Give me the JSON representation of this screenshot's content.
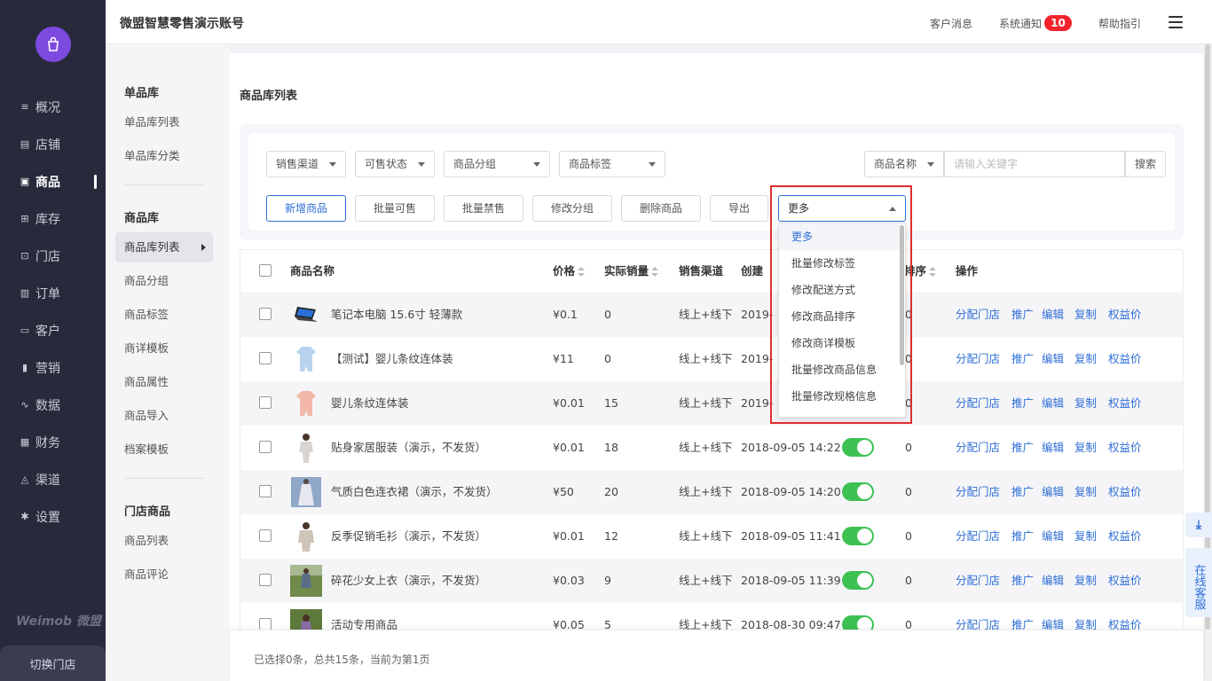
{
  "header": {
    "account_name": "微盟智慧零售演示账号",
    "customer_msg": "客户消息",
    "sys_notice": "系统通知",
    "notice_count": "10",
    "help": "帮助指引"
  },
  "nav": {
    "items": [
      {
        "label": "概况",
        "icon": "overview-icon"
      },
      {
        "label": "店铺",
        "icon": "shop-icon"
      },
      {
        "label": "商品",
        "icon": "goods-icon"
      },
      {
        "label": "库存",
        "icon": "inventory-icon"
      },
      {
        "label": "门店",
        "icon": "store-icon"
      },
      {
        "label": "订单",
        "icon": "order-icon"
      },
      {
        "label": "客户",
        "icon": "customer-icon"
      },
      {
        "label": "营销",
        "icon": "marketing-icon"
      },
      {
        "label": "数据",
        "icon": "data-icon"
      },
      {
        "label": "财务",
        "icon": "finance-icon"
      },
      {
        "label": "渠道",
        "icon": "channel-icon"
      },
      {
        "label": "设置",
        "icon": "settings-icon"
      }
    ],
    "active": "商品",
    "brand": "Weimob 微盟",
    "switch_store": "切换门店"
  },
  "subnav": {
    "group1": {
      "title": "单品库",
      "items": [
        "单品库列表",
        "单品库分类"
      ]
    },
    "group2": {
      "title": "商品库",
      "items": [
        "商品库列表",
        "商品分组",
        "商品标签",
        "商详模板",
        "商品属性",
        "商品导入",
        "档案模板"
      ]
    },
    "group3": {
      "title": "门店商品",
      "items": [
        "商品列表",
        "商品评论"
      ]
    },
    "active": "商品库列表"
  },
  "page": {
    "title": "商品库列表"
  },
  "filters": {
    "sales_channel": "销售渠道",
    "sale_status": "可售状态",
    "goods_group": "商品分组",
    "goods_tag": "商品标签",
    "search_field": "商品名称",
    "search_placeholder": "请输入关键字",
    "search_btn": "搜索"
  },
  "actions": {
    "add": "新增商品",
    "batch_sellable": "批量可售",
    "batch_forbid": "批量禁售",
    "modify_group": "修改分组",
    "delete": "删除商品",
    "export": "导出",
    "more": "更多"
  },
  "more_menu": {
    "options": [
      "更多",
      "批量修改标签",
      "修改配送方式",
      "修改商品排序",
      "修改商详模板",
      "批量修改商品信息",
      "批量修改规格信息"
    ],
    "selected": "更多"
  },
  "table": {
    "columns": {
      "name": "商品名称",
      "price": "价格",
      "sales": "实际销量",
      "channel": "销售渠道",
      "created": "创建",
      "sort": "排序",
      "ops": "操作"
    },
    "op_labels": [
      "分配门店",
      "推广",
      "编辑",
      "复制",
      "权益价"
    ],
    "rows": [
      {
        "name": "笔记本电脑 15.6寸 轻薄款",
        "price": "¥0.1",
        "sales": "0",
        "channel": "线上+线下",
        "created": "2019-",
        "sort": "0",
        "thumb": "laptop"
      },
      {
        "name": "【测试】婴儿条纹连体装",
        "price": "¥11",
        "sales": "0",
        "channel": "线上+线下",
        "created": "2019-",
        "sort": "0",
        "thumb": "baby-blue"
      },
      {
        "name": "婴儿条纹连体装",
        "price": "¥0.01",
        "sales": "15",
        "channel": "线上+线下",
        "created": "2019-",
        "sort": "0",
        "thumb": "baby-pink"
      },
      {
        "name": "贴身家居服装（演示，不发货）",
        "price": "¥0.01",
        "sales": "18",
        "channel": "线上+线下",
        "created": "2018-09-05 14:22",
        "sort": "0",
        "thumb": "woman"
      },
      {
        "name": "气质白色连衣裙（演示，不发货）",
        "price": "¥50",
        "sales": "20",
        "channel": "线上+线下",
        "created": "2018-09-05 14:20",
        "sort": "0",
        "thumb": "dress"
      },
      {
        "name": "反季促销毛衫（演示，不发货）",
        "price": "¥0.01",
        "sales": "12",
        "channel": "线上+线下",
        "created": "2018-09-05 11:41",
        "sort": "0",
        "thumb": "sweater"
      },
      {
        "name": "碎花少女上衣（演示，不发货）",
        "price": "¥0.03",
        "sales": "9",
        "channel": "线上+线下",
        "created": "2018-09-05 11:39",
        "sort": "0",
        "thumb": "outdoor"
      },
      {
        "name": "活动专用商品",
        "price": "¥0.05",
        "sales": "5",
        "channel": "线上+线下",
        "created": "2018-08-30 09:47",
        "sort": "0",
        "thumb": "outdoor2"
      }
    ]
  },
  "footer": {
    "summary": "已选择0条，总共15条，当前为第1页"
  },
  "float": {
    "service": "在线客服"
  },
  "colors": {
    "accent": "#2e6ed6",
    "nav_bg": "#282a3c",
    "toggle_on": "#3cc152",
    "highlight": "#e02f2f",
    "badge": "#f5222d"
  }
}
